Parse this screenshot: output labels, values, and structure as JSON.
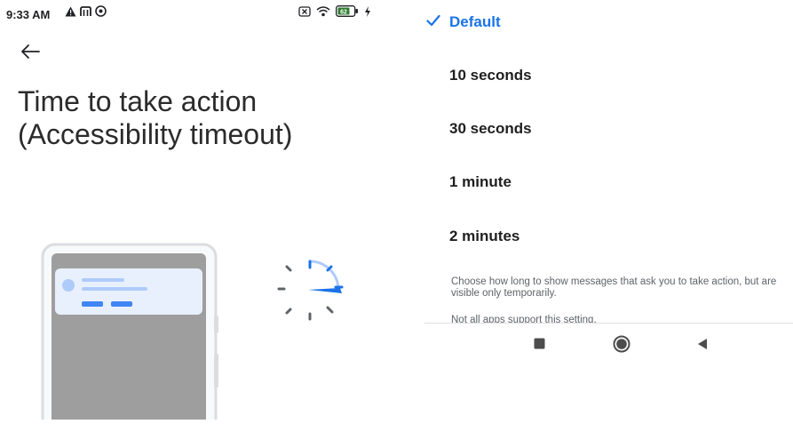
{
  "status_bar": {
    "time": "9:33 AM",
    "left_icons": [
      "warning-icon",
      "carrier-icon",
      "cast-icon"
    ],
    "right_icons": [
      "no-sim-icon",
      "wifi-icon",
      "battery-icon",
      "charging-icon"
    ],
    "battery_level": "62",
    "battery_color": "#2e7d32"
  },
  "header": {
    "back_icon": "back-arrow-icon",
    "title": "Time to take action (Accessibility timeout)"
  },
  "options": [
    {
      "label": "Default",
      "selected": true
    },
    {
      "label": "10 seconds",
      "selected": false
    },
    {
      "label": "30 seconds",
      "selected": false
    },
    {
      "label": "1 minute",
      "selected": false
    },
    {
      "label": "2 minutes",
      "selected": false
    }
  ],
  "description": "Choose how long to show messages that ask you to take action, but are visible only temporarily.",
  "note": "Not all apps support this setting.",
  "navbar": {
    "icons": [
      "recents-square-icon",
      "home-circle-icon",
      "back-triangle-icon"
    ]
  },
  "colors": {
    "accent": "#1a73e8",
    "text": "#1f1f1f",
    "secondary_text": "#5f6368"
  }
}
